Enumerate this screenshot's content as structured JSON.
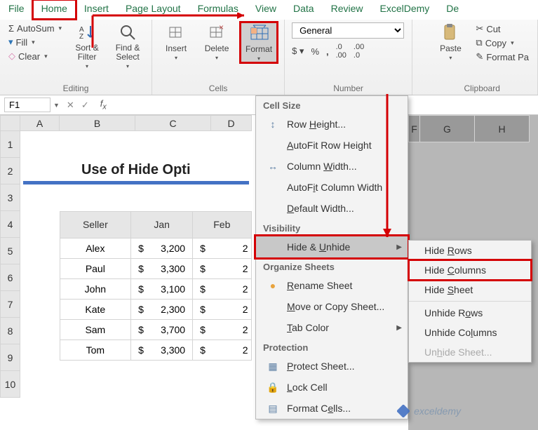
{
  "tabs": [
    "File",
    "Home",
    "Insert",
    "Page Layout",
    "Formulas",
    "View",
    "Data",
    "Review",
    "ExcelDemy",
    "De"
  ],
  "active_tab": 1,
  "ribbon": {
    "editing": {
      "autosum": "AutoSum",
      "fill": "Fill",
      "clear": "Clear",
      "sort_filter": "Sort & Filter",
      "find_select": "Find & Select",
      "label": "Editing"
    },
    "cells": {
      "insert": "Insert",
      "delete": "Delete",
      "format": "Format",
      "label": "Cells"
    },
    "number": {
      "format": "General",
      "label": "Number"
    },
    "clipboard": {
      "paste": "Paste",
      "cut": "Cut",
      "copy": "Copy",
      "format_painter": "Format Pa",
      "label": "Clipboard"
    }
  },
  "namebox": "F1",
  "grid": {
    "columns": [
      "A",
      "B",
      "C",
      "D",
      "F",
      "G",
      "H"
    ],
    "rows": [
      "1",
      "2",
      "3",
      "4",
      "5",
      "6",
      "7",
      "8",
      "9",
      "10"
    ],
    "selected_cols": [
      "F",
      "G",
      "H"
    ],
    "banner": "Use of Hide Opti",
    "headers": [
      "Seller",
      "Jan",
      "Feb"
    ],
    "data": [
      {
        "seller": "Alex",
        "jan": "3,200",
        "feb": "2"
      },
      {
        "seller": "Paul",
        "jan": "3,300",
        "feb": "2"
      },
      {
        "seller": "John",
        "jan": "3,100",
        "feb": "2"
      },
      {
        "seller": "Kate",
        "jan": "2,300",
        "feb": "2"
      },
      {
        "seller": "Sam",
        "jan": "3,700",
        "feb": "2"
      },
      {
        "seller": "Tom",
        "jan": "3,300",
        "feb": "2"
      }
    ]
  },
  "menu1": {
    "cell_size_h": "Cell Size",
    "row_height": "Row Height...",
    "autofit_row": "AutoFit Row Height",
    "col_width": "Column Width...",
    "autofit_col": "AutoFit Column Width",
    "default_width": "Default Width...",
    "visibility_h": "Visibility",
    "hide_unhide": "Hide & Unhide",
    "organize_h": "Organize Sheets",
    "rename": "Rename Sheet",
    "move_copy": "Move or Copy Sheet...",
    "tab_color": "Tab Color",
    "protection_h": "Protection",
    "protect": "Protect Sheet...",
    "lock": "Lock Cell",
    "format_cells": "Format Cells..."
  },
  "menu2": {
    "hide_rows": "Hide Rows",
    "hide_cols": "Hide Columns",
    "hide_sheet": "Hide Sheet",
    "unhide_rows": "Unhide Rows",
    "unhide_cols": "Unhide Columns",
    "unhide_sheet": "Unhide Sheet..."
  },
  "watermark": "exceldemy"
}
